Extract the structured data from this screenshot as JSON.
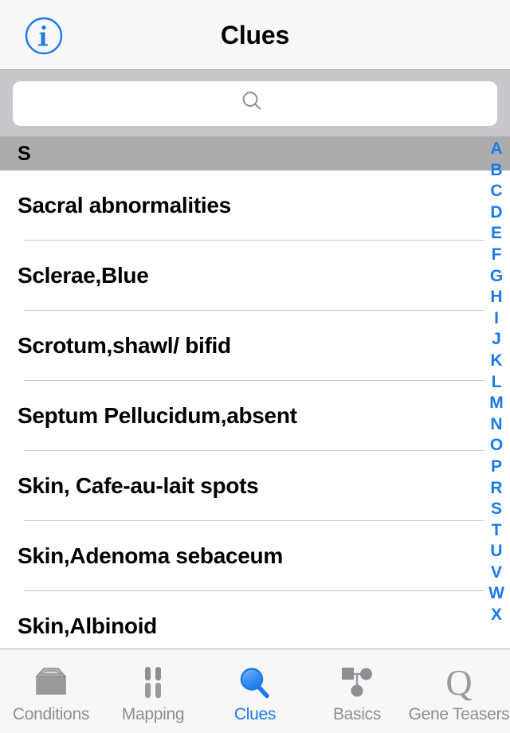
{
  "navbar": {
    "title": "Clues",
    "info_icon": "info-circle-icon"
  },
  "search": {
    "value": "",
    "placeholder": "",
    "icon": "search-icon"
  },
  "list": {
    "section_header": "S",
    "rows": [
      {
        "label": "Sacral abnormalities"
      },
      {
        "label": "Sclerae,Blue"
      },
      {
        "label": "Scrotum,shawl/ bifid"
      },
      {
        "label": "Septum Pellucidum,absent"
      },
      {
        "label": "Skin, Cafe-au-lait spots"
      },
      {
        "label": "Skin,Adenoma sebaceum"
      },
      {
        "label": "Skin,Albinoid"
      }
    ]
  },
  "alpha_index": {
    "letters": [
      "A",
      "B",
      "C",
      "D",
      "E",
      "F",
      "G",
      "H",
      "I",
      "J",
      "K",
      "L",
      "M",
      "N",
      "O",
      "P",
      "R",
      "S",
      "T",
      "U",
      "V",
      "W",
      "X"
    ]
  },
  "tabbar": {
    "active": "Clues",
    "tabs": [
      {
        "label": "Conditions",
        "icon": "card-box-icon"
      },
      {
        "label": "Mapping",
        "icon": "chromosomes-icon"
      },
      {
        "label": "Clues",
        "icon": "magnifier-icon"
      },
      {
        "label": "Basics",
        "icon": "pedigree-icon"
      },
      {
        "label": "Gene Teasers",
        "icon": "letter-q-icon"
      }
    ]
  },
  "colors": {
    "accent": "#1a7aeb",
    "nav_background": "#f7f7f7",
    "search_background": "#c8c7cc",
    "section_header": "#acacac",
    "inactive_tab": "#8e8e93",
    "separator": "#c8c7cc"
  }
}
